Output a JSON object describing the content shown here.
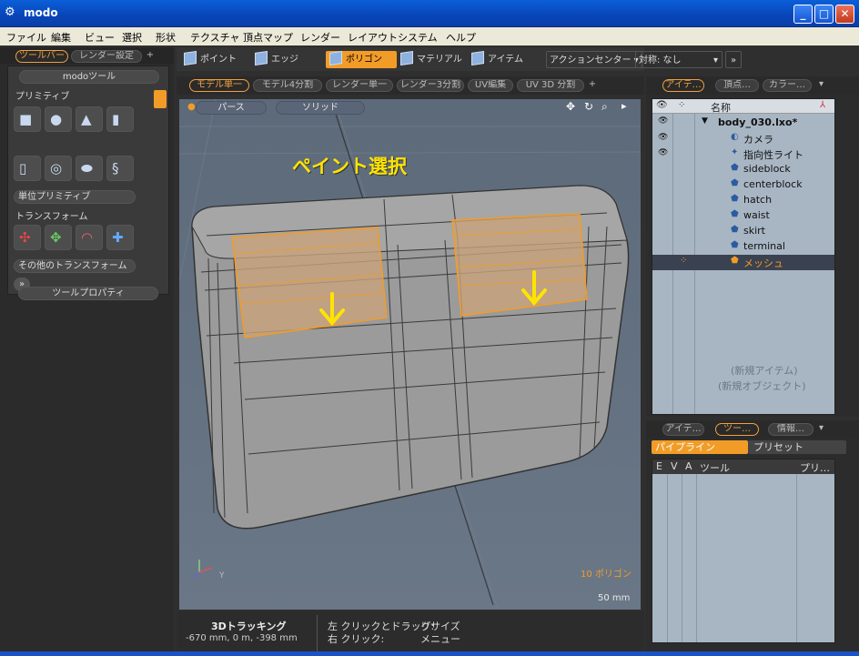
{
  "window": {
    "title": "modo",
    "app_icon": "modo-icon",
    "minimize": "_",
    "maximize": "□",
    "close": "✕"
  },
  "menu": [
    "ファイル",
    "編集",
    "ビュー",
    "選択",
    "形状",
    "テクスチャ",
    "頂点マップ",
    "レンダー",
    "レイアウト",
    "システム",
    "ヘルプ"
  ],
  "left_panel": {
    "tabs": [
      "ツールバー",
      "レンダー設定",
      "+"
    ],
    "header": "modoツール",
    "sections": {
      "primitives": "プリミティブ",
      "unit_primitive": "単位プリミティブ",
      "transform": "トランスフォーム",
      "other_transform": "その他のトランスフォーム",
      "more": "»"
    },
    "tool_properties": "ツールプロパティ",
    "primitive_icons": [
      "cube-icon",
      "sphere-icon",
      "cone-icon",
      "cylinder-icon",
      "capsule-icon",
      "torus-icon",
      "ellipsoid-icon",
      "toroid-icon"
    ],
    "transform_icons": [
      "transform-icon",
      "move-icon",
      "rotate-icon",
      "scale-icon"
    ]
  },
  "toolbar": {
    "modes": [
      {
        "label": "ポイント",
        "icon": "vertex-icon",
        "active": false
      },
      {
        "label": "エッジ",
        "icon": "edge-icon",
        "active": false
      },
      {
        "label": "ポリゴン",
        "icon": "polygon-icon",
        "active": true
      },
      {
        "label": "マテリアル",
        "icon": "material-icon",
        "active": false
      },
      {
        "label": "アイテム",
        "icon": "item-icon",
        "active": false
      }
    ],
    "action_center": "アクションセンター",
    "symmetry": "対称: なし",
    "more": "»",
    "accent": "#f29c28"
  },
  "viewport": {
    "tabs": [
      "モデル単一",
      "モデル4分割",
      "レンダー単一",
      "レンダー3分割",
      "UV編集",
      "UV 3D 分割",
      "+"
    ],
    "perspective": "パース",
    "shading": "ソリッド",
    "annotation": "ペイント選択",
    "poly_count": "10 ポリゴン",
    "scale": "50 mm",
    "axis_y": "Y"
  },
  "status": {
    "tracking_title": "3Dトラッキング",
    "coords": "-670 mm, 0 m, -398 mm",
    "hint1_key": "左 クリックとドラッグ:",
    "hint1_val": "リサイズ",
    "hint2_key": "右 クリック:",
    "hint2_val": "メニュー"
  },
  "items_panel": {
    "tabs": [
      "アイテ…",
      "頂点…",
      "カラー…"
    ],
    "column_name": "名称",
    "root": "body_030.lxo*",
    "items": [
      {
        "label": "カメラ",
        "icon": "camera-icon",
        "eye": true
      },
      {
        "label": "指向性ライト",
        "icon": "light-icon",
        "eye": true
      },
      {
        "label": "sideblock",
        "icon": "mesh-icon"
      },
      {
        "label": "centerblock",
        "icon": "mesh-icon"
      },
      {
        "label": "hatch",
        "icon": "mesh-icon"
      },
      {
        "label": "waist",
        "icon": "mesh-icon"
      },
      {
        "label": "skirt",
        "icon": "mesh-icon"
      },
      {
        "label": "terminal",
        "icon": "mesh-icon"
      },
      {
        "label": "メッシュ",
        "icon": "mesh-icon",
        "selected": true
      }
    ],
    "new_item": "(新規アイテム)",
    "new_object": "(新規オブジェクト)"
  },
  "tools_panel": {
    "tabs": [
      "アイテ…",
      "ツー…",
      "情報…"
    ],
    "subtabs": [
      "パイプライン",
      "プリセット"
    ],
    "columns": [
      "E",
      "V",
      "A",
      "ツール",
      "プリ…"
    ]
  }
}
